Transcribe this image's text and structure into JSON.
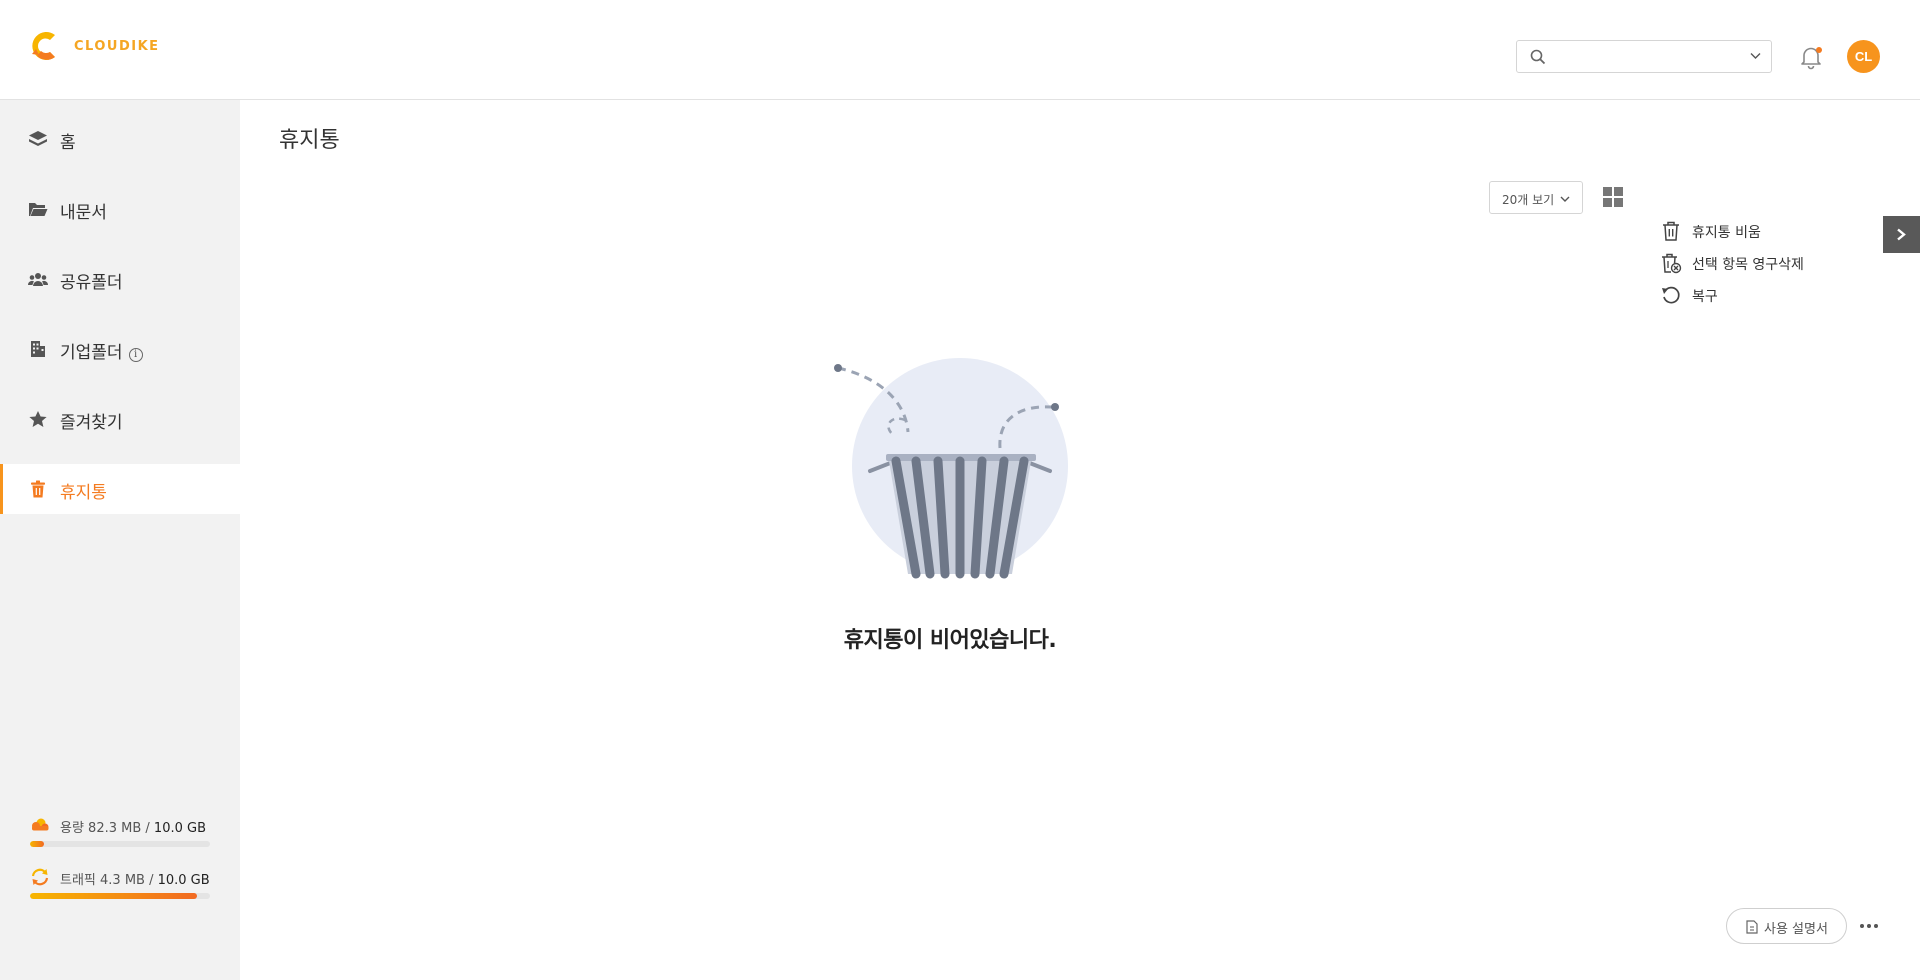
{
  "header": {
    "logo_text": "CLOUDIKE",
    "search": {
      "value": "",
      "placeholder": ""
    },
    "avatar_initials": "CL",
    "notification_dot": true
  },
  "sidebar": {
    "items": [
      {
        "label": "홈",
        "icon": "layers-icon",
        "active": false
      },
      {
        "label": "내문서",
        "icon": "folder-open-icon",
        "active": false
      },
      {
        "label": "공유폴더",
        "icon": "users-icon",
        "active": false
      },
      {
        "label": "기업폴더",
        "icon": "building-icon",
        "active": false,
        "info_glyph": "i"
      },
      {
        "label": "즐겨찾기",
        "icon": "star-icon",
        "active": false
      },
      {
        "label": "휴지통",
        "icon": "trash-icon",
        "active": true
      }
    ],
    "storage": {
      "label": "용량 82.3 MB / ",
      "total": "10.0 GB",
      "fraction": 0.008
    },
    "traffic": {
      "label": "트래픽 4.3 MB / ",
      "total": "10.0 GB",
      "fraction": 0.93
    }
  },
  "main": {
    "title": "휴지통",
    "view_select": "20개 보기",
    "actions": [
      {
        "label": "휴지통 비움",
        "icon": "trash-outline-icon"
      },
      {
        "label": "선택 항목 영구삭제",
        "icon": "trash-delete-icon"
      },
      {
        "label": "복구",
        "icon": "restore-icon"
      }
    ],
    "empty_message": "휴지통이 비어있습니다."
  },
  "footer": {
    "manual_label": "사용 설명서"
  },
  "colors": {
    "accent": "#f7941d",
    "active_text": "#f47b20",
    "sidebar_bg": "#f2f2f2",
    "toggle_bg": "#595959"
  }
}
